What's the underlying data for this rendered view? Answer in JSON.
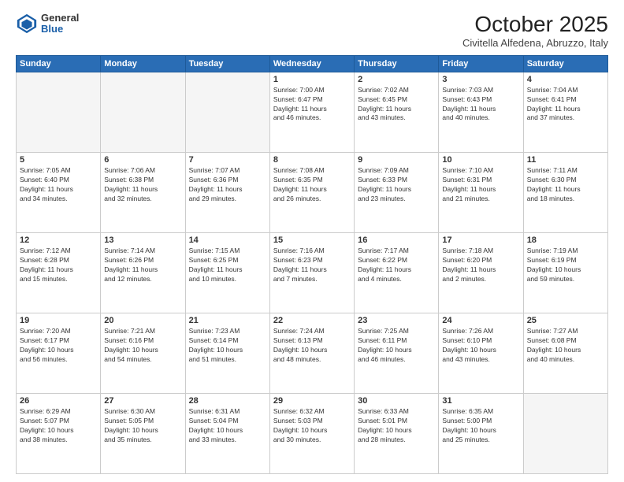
{
  "header": {
    "logo": {
      "general": "General",
      "blue": "Blue"
    },
    "title": "October 2025",
    "subtitle": "Civitella Alfedena, Abruzzo, Italy"
  },
  "days_of_week": [
    "Sunday",
    "Monday",
    "Tuesday",
    "Wednesday",
    "Thursday",
    "Friday",
    "Saturday"
  ],
  "weeks": [
    [
      {
        "day": "",
        "info": ""
      },
      {
        "day": "",
        "info": ""
      },
      {
        "day": "",
        "info": ""
      },
      {
        "day": "1",
        "info": "Sunrise: 7:00 AM\nSunset: 6:47 PM\nDaylight: 11 hours\nand 46 minutes."
      },
      {
        "day": "2",
        "info": "Sunrise: 7:02 AM\nSunset: 6:45 PM\nDaylight: 11 hours\nand 43 minutes."
      },
      {
        "day": "3",
        "info": "Sunrise: 7:03 AM\nSunset: 6:43 PM\nDaylight: 11 hours\nand 40 minutes."
      },
      {
        "day": "4",
        "info": "Sunrise: 7:04 AM\nSunset: 6:41 PM\nDaylight: 11 hours\nand 37 minutes."
      }
    ],
    [
      {
        "day": "5",
        "info": "Sunrise: 7:05 AM\nSunset: 6:40 PM\nDaylight: 11 hours\nand 34 minutes."
      },
      {
        "day": "6",
        "info": "Sunrise: 7:06 AM\nSunset: 6:38 PM\nDaylight: 11 hours\nand 32 minutes."
      },
      {
        "day": "7",
        "info": "Sunrise: 7:07 AM\nSunset: 6:36 PM\nDaylight: 11 hours\nand 29 minutes."
      },
      {
        "day": "8",
        "info": "Sunrise: 7:08 AM\nSunset: 6:35 PM\nDaylight: 11 hours\nand 26 minutes."
      },
      {
        "day": "9",
        "info": "Sunrise: 7:09 AM\nSunset: 6:33 PM\nDaylight: 11 hours\nand 23 minutes."
      },
      {
        "day": "10",
        "info": "Sunrise: 7:10 AM\nSunset: 6:31 PM\nDaylight: 11 hours\nand 21 minutes."
      },
      {
        "day": "11",
        "info": "Sunrise: 7:11 AM\nSunset: 6:30 PM\nDaylight: 11 hours\nand 18 minutes."
      }
    ],
    [
      {
        "day": "12",
        "info": "Sunrise: 7:12 AM\nSunset: 6:28 PM\nDaylight: 11 hours\nand 15 minutes."
      },
      {
        "day": "13",
        "info": "Sunrise: 7:14 AM\nSunset: 6:26 PM\nDaylight: 11 hours\nand 12 minutes."
      },
      {
        "day": "14",
        "info": "Sunrise: 7:15 AM\nSunset: 6:25 PM\nDaylight: 11 hours\nand 10 minutes."
      },
      {
        "day": "15",
        "info": "Sunrise: 7:16 AM\nSunset: 6:23 PM\nDaylight: 11 hours\nand 7 minutes."
      },
      {
        "day": "16",
        "info": "Sunrise: 7:17 AM\nSunset: 6:22 PM\nDaylight: 11 hours\nand 4 minutes."
      },
      {
        "day": "17",
        "info": "Sunrise: 7:18 AM\nSunset: 6:20 PM\nDaylight: 11 hours\nand 2 minutes."
      },
      {
        "day": "18",
        "info": "Sunrise: 7:19 AM\nSunset: 6:19 PM\nDaylight: 10 hours\nand 59 minutes."
      }
    ],
    [
      {
        "day": "19",
        "info": "Sunrise: 7:20 AM\nSunset: 6:17 PM\nDaylight: 10 hours\nand 56 minutes."
      },
      {
        "day": "20",
        "info": "Sunrise: 7:21 AM\nSunset: 6:16 PM\nDaylight: 10 hours\nand 54 minutes."
      },
      {
        "day": "21",
        "info": "Sunrise: 7:23 AM\nSunset: 6:14 PM\nDaylight: 10 hours\nand 51 minutes."
      },
      {
        "day": "22",
        "info": "Sunrise: 7:24 AM\nSunset: 6:13 PM\nDaylight: 10 hours\nand 48 minutes."
      },
      {
        "day": "23",
        "info": "Sunrise: 7:25 AM\nSunset: 6:11 PM\nDaylight: 10 hours\nand 46 minutes."
      },
      {
        "day": "24",
        "info": "Sunrise: 7:26 AM\nSunset: 6:10 PM\nDaylight: 10 hours\nand 43 minutes."
      },
      {
        "day": "25",
        "info": "Sunrise: 7:27 AM\nSunset: 6:08 PM\nDaylight: 10 hours\nand 40 minutes."
      }
    ],
    [
      {
        "day": "26",
        "info": "Sunrise: 6:29 AM\nSunset: 5:07 PM\nDaylight: 10 hours\nand 38 minutes."
      },
      {
        "day": "27",
        "info": "Sunrise: 6:30 AM\nSunset: 5:05 PM\nDaylight: 10 hours\nand 35 minutes."
      },
      {
        "day": "28",
        "info": "Sunrise: 6:31 AM\nSunset: 5:04 PM\nDaylight: 10 hours\nand 33 minutes."
      },
      {
        "day": "29",
        "info": "Sunrise: 6:32 AM\nSunset: 5:03 PM\nDaylight: 10 hours\nand 30 minutes."
      },
      {
        "day": "30",
        "info": "Sunrise: 6:33 AM\nSunset: 5:01 PM\nDaylight: 10 hours\nand 28 minutes."
      },
      {
        "day": "31",
        "info": "Sunrise: 6:35 AM\nSunset: 5:00 PM\nDaylight: 10 hours\nand 25 minutes."
      },
      {
        "day": "",
        "info": ""
      }
    ]
  ]
}
